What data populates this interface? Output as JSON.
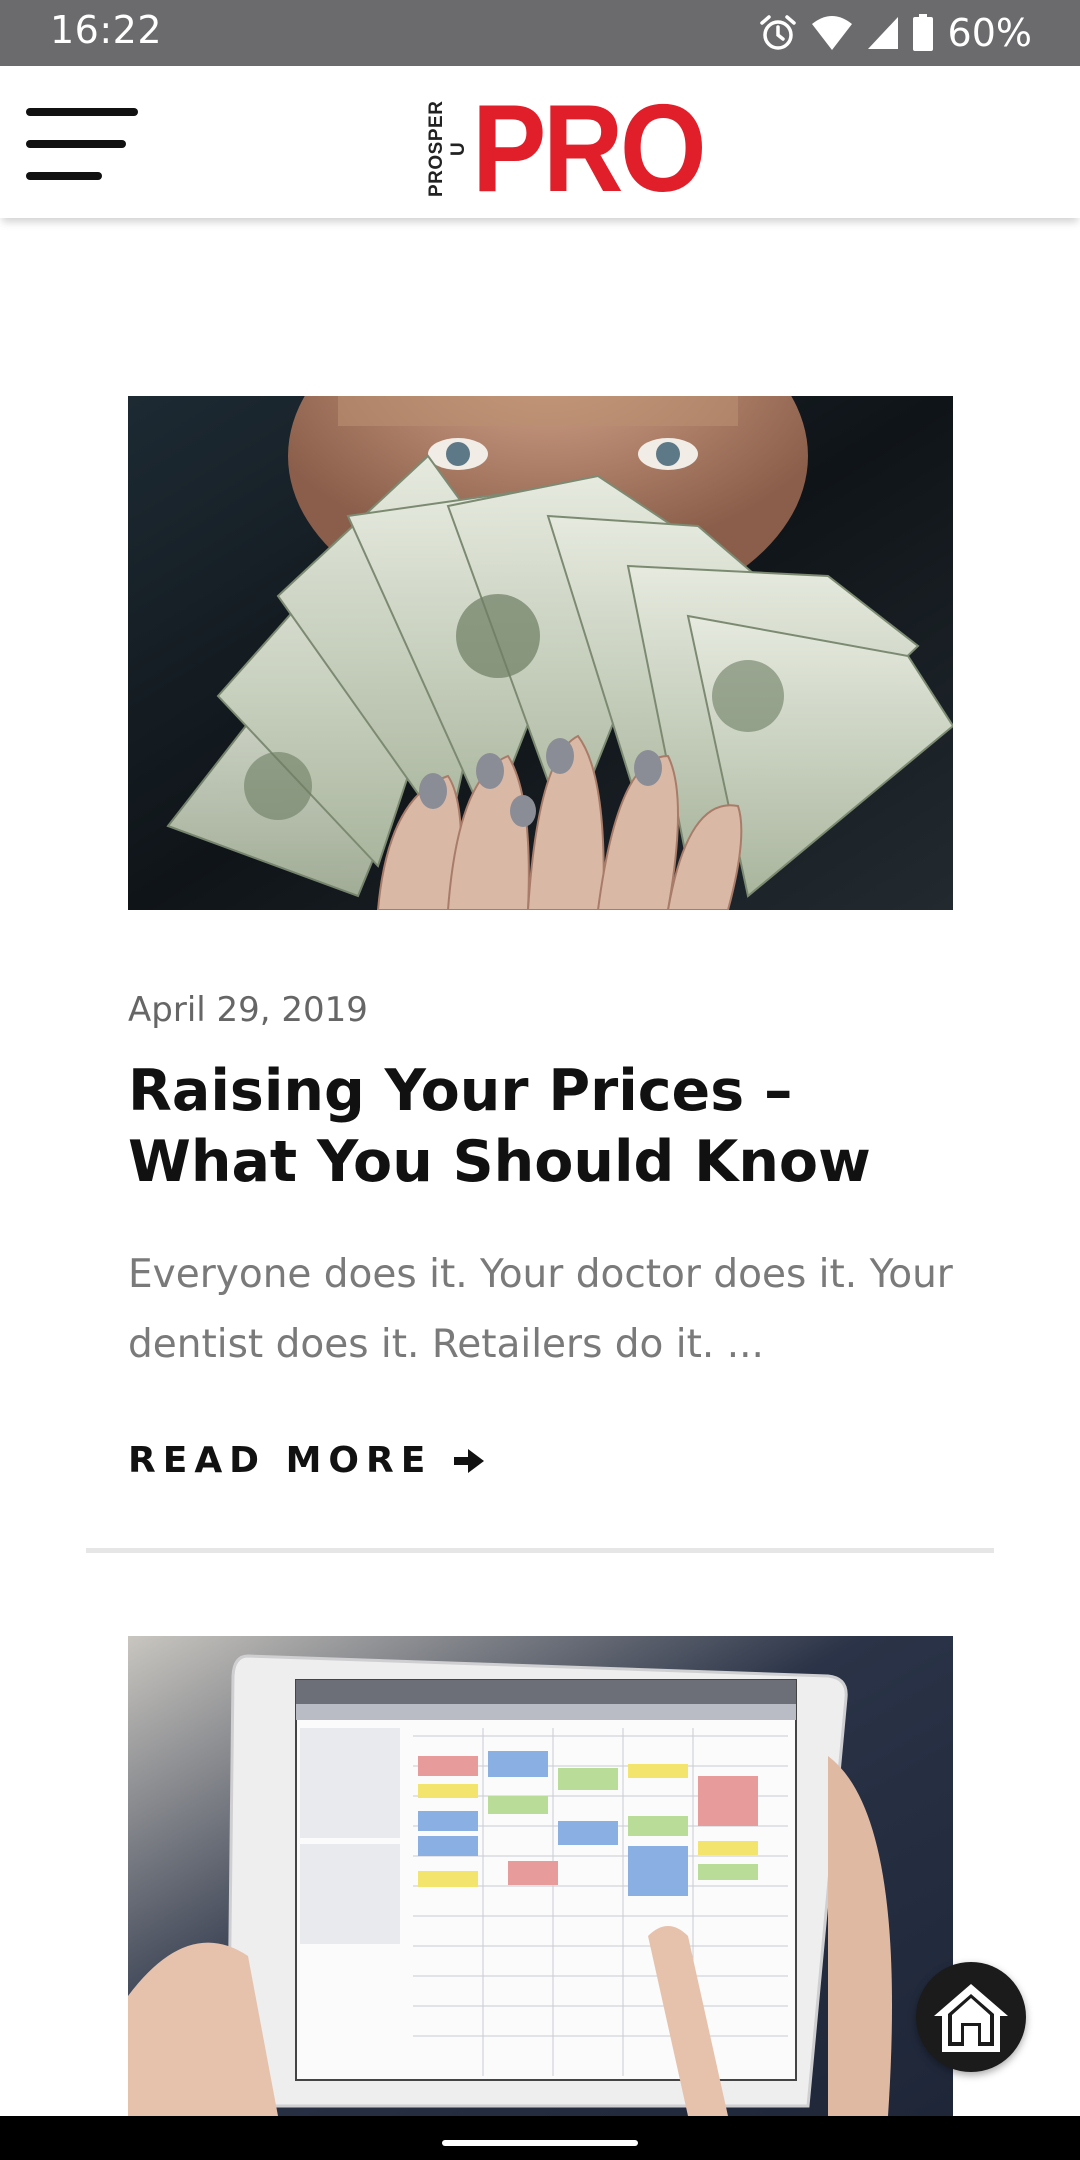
{
  "status_bar": {
    "time": "16:22",
    "battery": "60%",
    "icons": [
      "alarm-icon",
      "wifi-icon",
      "signal-icon",
      "battery-icon"
    ]
  },
  "header": {
    "logo_small": "PROSPER U",
    "logo_main": "PRO",
    "brand_color": "#e01f2a",
    "menu_icon": "hamburger-menu-icon"
  },
  "articles": [
    {
      "image": "photo of a person fanning out a handful of US dollar bills in front of their face",
      "date": "April 29, 2019",
      "title": "Raising Your Prices – What You Should Know",
      "excerpt": "Everyone does it. Your doctor does it. Your dentist does it. Retailers do it. ...",
      "read_more": "READ MORE"
    },
    {
      "image": "photo of hands holding a tablet that shows a weekly calendar app"
    }
  ],
  "fab": {
    "icon": "home-icon"
  }
}
